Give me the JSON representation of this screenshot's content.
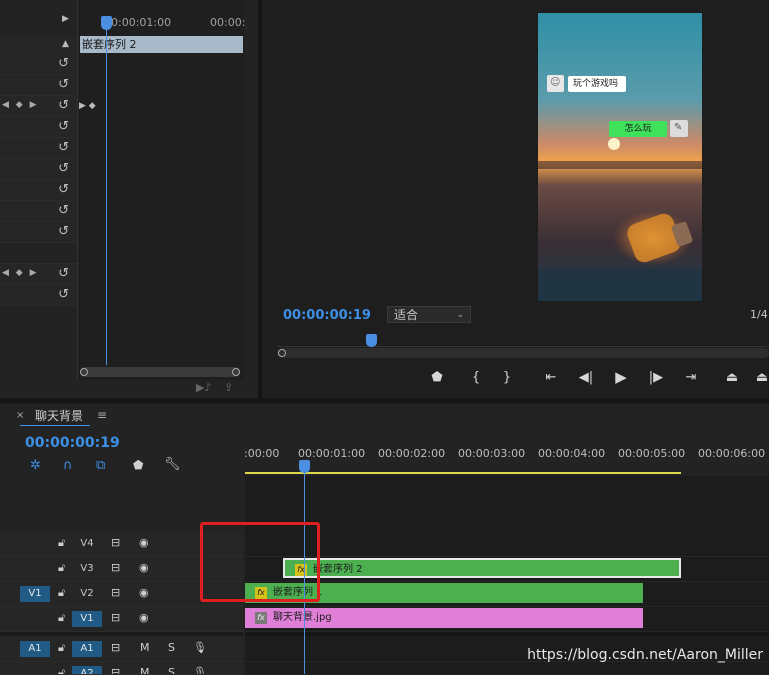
{
  "effect_controls": {
    "ruler_time": "00:00:01:00",
    "ruler_time_right": "00:00:",
    "clip_name": "嵌套序列 2"
  },
  "program_monitor": {
    "timecode": "00:00:00:19",
    "fit_label": "适合",
    "fraction": "1/4",
    "bubble_left": "玩个游戏吗",
    "bubble_right": "怎么玩"
  },
  "timeline": {
    "tab_title": "聊天背景",
    "timecode": "00:00:00:19",
    "ruler_labels": [
      ":00:00",
      "00:00:01:00",
      "00:00:02:00",
      "00:00:03:00",
      "00:00:04:00",
      "00:00:05:00",
      "00:00:06:00"
    ],
    "tracks": {
      "v4": "V4",
      "v3": "V3",
      "v2": "V2",
      "v1": "V1",
      "v1_src": "V1",
      "a1_src": "A1",
      "a1": "A1",
      "a2": "A2",
      "m": "M",
      "s": "S"
    },
    "clips": {
      "nested2": "嵌套序列 2",
      "nested1": "嵌套序列 1",
      "bg": "聊天背景.jpg"
    },
    "colors": {
      "nested": "#4caf50",
      "image": "#e07fd8",
      "red_box": "#e02020"
    }
  },
  "watermark": "https://blog.csdn.net/Aaron_Miller"
}
